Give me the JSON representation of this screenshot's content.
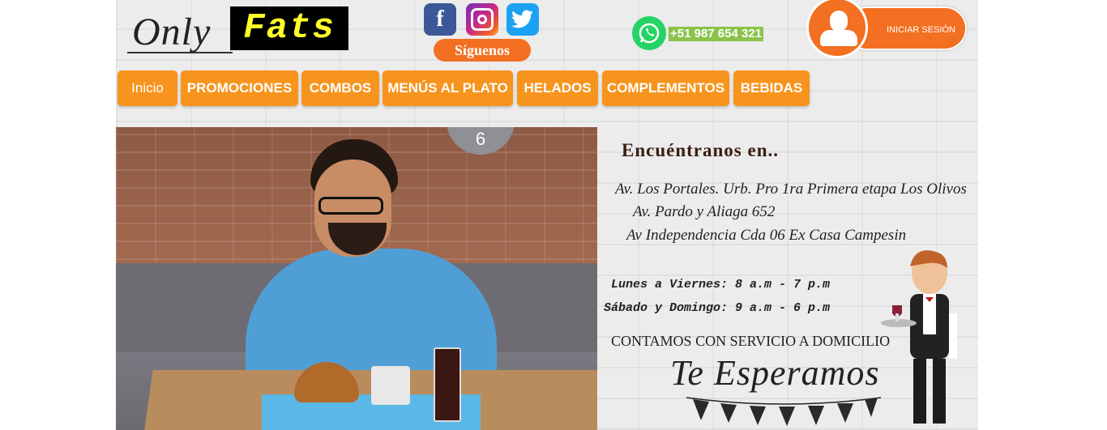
{
  "brand": {
    "logo_word1": "Only",
    "logo_word2": "Fats"
  },
  "social": {
    "facebook_icon": "facebook-icon",
    "instagram_icon": "instagram-icon",
    "twitter_icon": "twitter-icon",
    "follow_label": "Síguenos"
  },
  "contact": {
    "whatsapp_icon": "whatsapp-icon",
    "phone": "+51 987 654 321"
  },
  "login": {
    "label": "INICIAR SESIÓN",
    "icon": "user-avatar-icon"
  },
  "nav": {
    "items": [
      {
        "label": "Inicio"
      },
      {
        "label": "PROMOCIONES"
      },
      {
        "label": "COMBOS"
      },
      {
        "label": "MENÚS AL PLATO"
      },
      {
        "label": "HELADOS"
      },
      {
        "label": "COMPLEMENTOS"
      },
      {
        "label": "BEBIDAS"
      }
    ]
  },
  "banner": {
    "clock_number": "6",
    "title": "Encuéntranos en..",
    "addresses": [
      "Av. Los Portales. Urb. Pro 1ra Primera etapa Los Olivos",
      "Av. Pardo y Aliaga 652",
      "Av Independencia Cda 06 Ex Casa Campesin"
    ],
    "hours": [
      "Lunes a Viernes: 8 a.m - 7 p.m",
      "Sábado y Domingo: 9 a.m - 6 p.m"
    ],
    "delivery": "CONTAMOS CON SERVICIO A DOMICILIO",
    "closing": "Te Esperamos"
  },
  "colors": {
    "accent_orange": "#f7941d",
    "button_orange": "#f36f21",
    "whatsapp_green": "#25d366",
    "phone_bg": "#8bc34a",
    "logo_yellow": "#ffff2a"
  }
}
